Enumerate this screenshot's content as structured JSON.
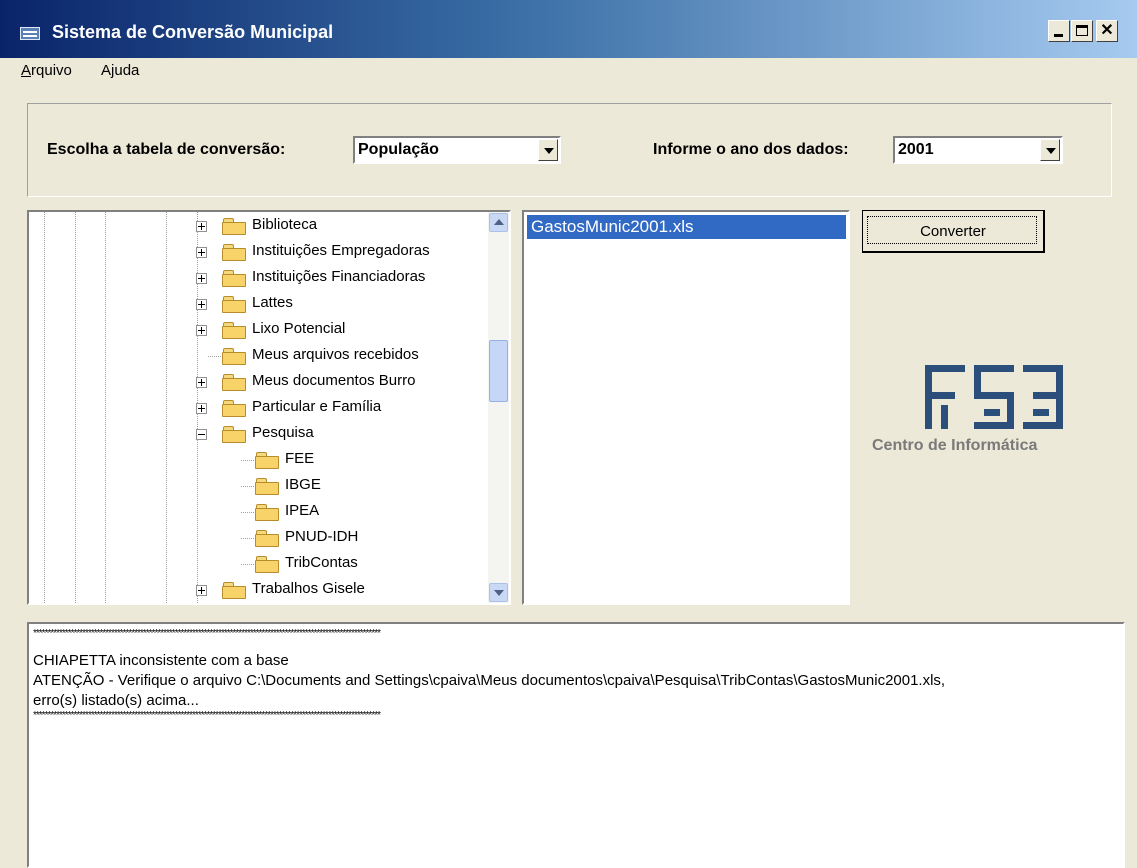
{
  "window": {
    "title": "Sistema de Conversão Municipal"
  },
  "menu": {
    "items": [
      "Arquivo",
      "Ajuda"
    ]
  },
  "form": {
    "table_label": "Escolha a tabela de conversão:",
    "table_value": "População",
    "year_label": "Informe o ano dos dados:",
    "year_value": "2001"
  },
  "tree": {
    "items": [
      {
        "label": "Biblioteca",
        "expander": "plus"
      },
      {
        "label": "Instituições Empregadoras",
        "expander": "plus"
      },
      {
        "label": "Instituições Financiadoras",
        "expander": "plus"
      },
      {
        "label": "Lattes",
        "expander": "plus"
      },
      {
        "label": "Lixo Potencial",
        "expander": "plus"
      },
      {
        "label": "Meus arquivos recebidos",
        "expander": "none"
      },
      {
        "label": "Meus documentos Burro",
        "expander": "plus"
      },
      {
        "label": "Particular e Família",
        "expander": "plus"
      },
      {
        "label": "Pesquisa",
        "expander": "minus"
      },
      {
        "label": "FEE",
        "expander": "none"
      },
      {
        "label": "IBGE",
        "expander": "none"
      },
      {
        "label": "IPEA",
        "expander": "none"
      },
      {
        "label": "PNUD-IDH",
        "expander": "none"
      },
      {
        "label": "TribContas",
        "expander": "none"
      },
      {
        "label": "Trabalhos Gisele",
        "expander": "plus"
      }
    ]
  },
  "files": {
    "items": [
      "GastosMunic2001.xls"
    ],
    "selected": "GastosMunic2001.xls"
  },
  "actions": {
    "convert_label": "Converter"
  },
  "logo": {
    "caption": "Centro de Informática",
    "color": "#2b4f7a"
  },
  "log": {
    "separator": "************************************************************************************************************************",
    "lines": [
      "CHIAPETTA inconsistente com a base",
      "ATENÇÃO - Verifique o arquivo C:\\Documents and Settings\\cpaiva\\Meus documentos\\cpaiva\\Pesquisa\\TribContas\\GastosMunic2001.xls,",
      "erro(s) listado(s) acima..."
    ]
  },
  "colors": {
    "selection": "#316ac5",
    "window_bg": "#ece9d8"
  }
}
